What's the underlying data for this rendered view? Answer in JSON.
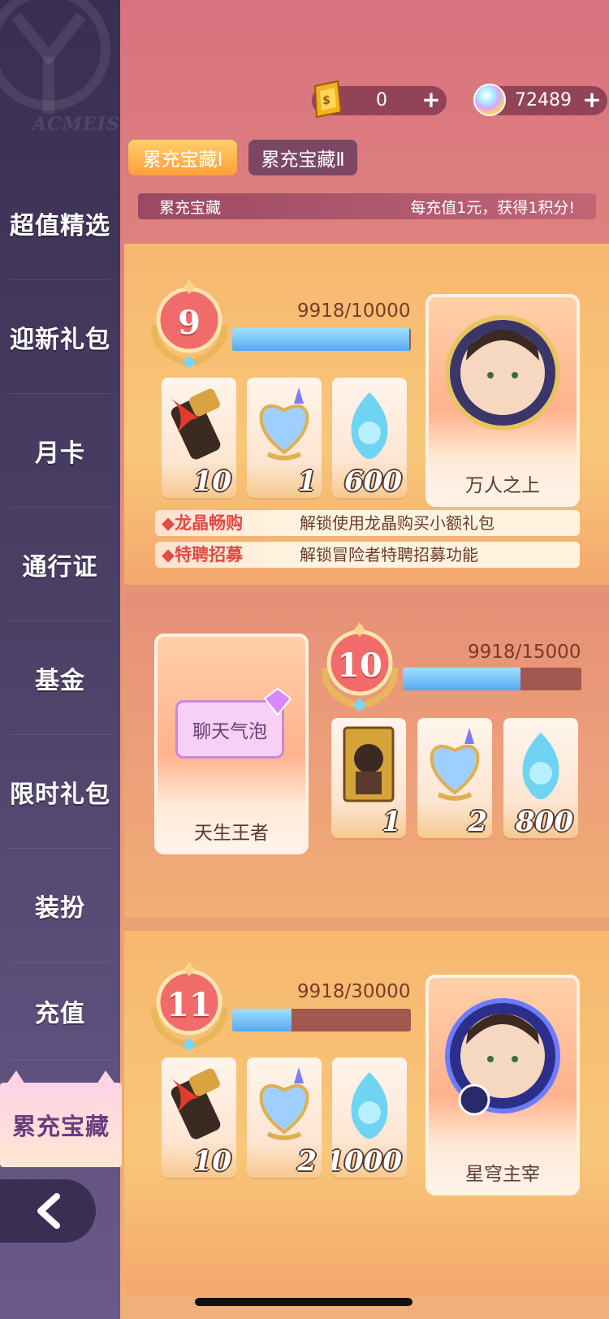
{
  "sidebar": {
    "logo_text": "ACMEIS",
    "items": [
      {
        "label": "超值精选"
      },
      {
        "label": "迎新礼包"
      },
      {
        "label": "月卡"
      },
      {
        "label": "通行证"
      },
      {
        "label": "基金"
      },
      {
        "label": "限时礼包"
      },
      {
        "label": "装扮"
      },
      {
        "label": "充值"
      },
      {
        "label": "累充宝藏"
      }
    ],
    "active_index": 8,
    "back_icon": "chevron-left-icon"
  },
  "currency": {
    "gold": {
      "value": "0",
      "icon": "gold-ticket-icon"
    },
    "crystal": {
      "value": "72489",
      "icon": "rainbow-crystal-icon"
    }
  },
  "tabs": [
    {
      "label": "累充宝藏Ⅰ",
      "active": true
    },
    {
      "label": "累充宝藏Ⅱ",
      "active": false
    }
  ],
  "info_bar": {
    "title": "累充宝藏",
    "description": "每充值1元，获得1积分!"
  },
  "tiers": [
    {
      "level": "9",
      "progress_text": "9918/10000",
      "progress": 0.9918,
      "items": [
        {
          "icon": "scroll-icon",
          "qty": "10"
        },
        {
          "icon": "blue-crystal-heart-icon",
          "qty": "1"
        },
        {
          "icon": "blue-flame-icon",
          "qty": "600"
        }
      ],
      "reward": {
        "icon": "avatar-frame-icon",
        "label": "万人之上"
      },
      "perks": [
        {
          "tag": "龙晶畅购",
          "desc": "解锁使用龙晶购买小额礼包"
        },
        {
          "tag": "特聘招募",
          "desc": "解锁冒险者特聘招募功能"
        }
      ]
    },
    {
      "level": "10",
      "progress_text": "9918/15000",
      "progress": 0.6612,
      "items": [
        {
          "icon": "character-card-icon",
          "qty": "1"
        },
        {
          "icon": "blue-crystal-heart-icon",
          "qty": "2"
        },
        {
          "icon": "blue-flame-icon",
          "qty": "800"
        }
      ],
      "reward": {
        "icon": "chat-bubble-icon",
        "bubble_text": "聊天气泡",
        "label": "天生王者"
      }
    },
    {
      "level": "11",
      "progress_text": "9918/30000",
      "progress": 0.3306,
      "items": [
        {
          "icon": "scroll-icon",
          "qty": "10"
        },
        {
          "icon": "blue-crystal-heart-icon",
          "qty": "2"
        },
        {
          "icon": "blue-flame-icon",
          "qty": "1000"
        }
      ],
      "reward": {
        "icon": "avatar-frame-icon",
        "label": "星穹主宰"
      }
    }
  ],
  "colors": {
    "sidebar_bg": "#3a2f52",
    "progress_fill": "#56a9f0",
    "accent_red": "#e04b45",
    "tab_active": "#ff9e3a"
  }
}
